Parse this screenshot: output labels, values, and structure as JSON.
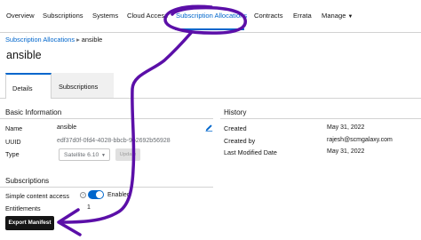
{
  "nav": {
    "items": [
      "Overview",
      "Subscriptions",
      "Systems",
      "Cloud Access",
      "Subscription Allocations",
      "Contracts",
      "Errata",
      "Manage"
    ],
    "active": "Subscription Allocations"
  },
  "breadcrumb": {
    "parent": "Subscription Allocations",
    "separator": "▸",
    "current": "ansible"
  },
  "page_title": "ansible",
  "tabs": [
    "Details",
    "Subscriptions"
  ],
  "basic_info": {
    "heading": "Basic Information",
    "name_label": "Name",
    "name_value": "ansible",
    "uuid_label": "UUID",
    "uuid_value": "edf37d0f-0fd4-4028-bbcb-9b2692b56928",
    "type_label": "Type",
    "type_value": "Satellite 6.10",
    "type_button": "Update"
  },
  "subscriptions": {
    "heading": "Subscriptions",
    "simple_content_label": "Simple content access",
    "simple_content_state": "Enabled",
    "entitlements_label": "Entitlements",
    "entitlements_value": "1",
    "export_button": "Export Manifest"
  },
  "history": {
    "heading": "History",
    "created_label": "Created",
    "created_value": "May 31, 2022",
    "created_by_label": "Created by",
    "created_by_value": "rajesh@scmgalaxy.com",
    "modified_label": "Last Modified Date",
    "modified_value": "May 31, 2022"
  },
  "colors": {
    "accent": "#0066cc",
    "annotation": "#5b0fa8",
    "text": "#151515"
  },
  "icons": {
    "edit": "pencil-icon",
    "help": "question-circle-icon",
    "dropdown": "caret-down-icon"
  }
}
